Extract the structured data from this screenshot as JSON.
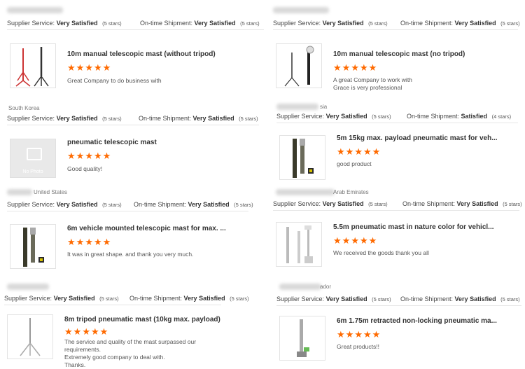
{
  "labels": {
    "supplier_service": "Supplier Service:",
    "ontime_shipment": "On-time Shipment:"
  },
  "reviews": [
    {
      "country": "",
      "supplier_rating": "Very Satisfied",
      "supplier_stars": "(5 stars)",
      "shipment_rating": "Very Satisfied",
      "shipment_stars": "(5 stars)",
      "product_title": "10m manual telescopic mast (without tripod)",
      "star_count": 5,
      "comment": [
        "Great Company to do business with"
      ],
      "thumb": "mast-red-tripod"
    },
    {
      "country": "",
      "supplier_rating": "Very Satisfied",
      "supplier_stars": "(5 stars)",
      "shipment_rating": "Very Satisfied",
      "shipment_stars": "(5 stars)",
      "product_title": "10m manual telescopic mast (no tripod)",
      "star_count": 5,
      "comment": [
        "A great Company to work with",
        "Grace is very professional"
      ],
      "thumb": "mast-black-tripod"
    },
    {
      "country": "South Korea",
      "supplier_rating": "Very Satisfied",
      "supplier_stars": "(5 stars)",
      "shipment_rating": "Very Satisfied",
      "shipment_stars": "(5 stars)",
      "product_title": "pneumatic telescopic mast",
      "star_count": 5,
      "comment": [
        "Good quality!"
      ],
      "thumb": "no-photo",
      "no_photo_label": "No Photo"
    },
    {
      "country": "sia",
      "supplier_rating": "Very Satisfied",
      "supplier_stars": "(5 stars)",
      "shipment_rating": "Satisfied",
      "shipment_stars": "(4 stars)",
      "product_title": "5m 15kg max. payload pneumatic mast for veh...",
      "star_count": 5,
      "comment": [
        "good product"
      ],
      "thumb": "mast-vehicle"
    },
    {
      "country": "United States",
      "supplier_rating": "Very Satisfied",
      "supplier_stars": "(5 stars)",
      "shipment_rating": "Very Satisfied",
      "shipment_stars": "(5 stars)",
      "product_title": "6m vehicle mounted telescopic mast for max. ...",
      "star_count": 5,
      "comment": [
        "It was in great shape. and thank you very much."
      ],
      "thumb": "mast-vehicle"
    },
    {
      "country": "Arab Emirates",
      "supplier_rating": "Very Satisfied",
      "supplier_stars": "(5 stars)",
      "shipment_rating": "Very Satisfied",
      "shipment_stars": "(5 stars)",
      "product_title": "5.5m pneumatic mast in nature color for vehicl...",
      "star_count": 5,
      "comment": [
        "We received the goods thank you all"
      ],
      "thumb": "mast-silver"
    },
    {
      "country": "",
      "supplier_rating": "Very Satisfied",
      "supplier_stars": "(5 stars)",
      "shipment_rating": "Very Satisfied",
      "shipment_stars": "(5 stars)",
      "product_title": "8m tripod pneumatic mast (10kg max. payload)",
      "star_count": 5,
      "comment": [
        "The service and quality of the mast surpassed our requirements.",
        "Extremely good company to deal with.",
        "Thanks."
      ],
      "thumb": "mast-tripod-silver"
    },
    {
      "country": "ador",
      "supplier_rating": "Very Satisfied",
      "supplier_stars": "(5 stars)",
      "shipment_rating": "Very Satisfied",
      "shipment_stars": "(5 stars)",
      "product_title": "6m 1.75m retracted non-locking pneumatic ma...",
      "star_count": 5,
      "comment": [
        "Great products!!"
      ],
      "thumb": "mast-single"
    }
  ],
  "colors": {
    "star": "#ff6a00",
    "divider": "#e6e6e6"
  }
}
